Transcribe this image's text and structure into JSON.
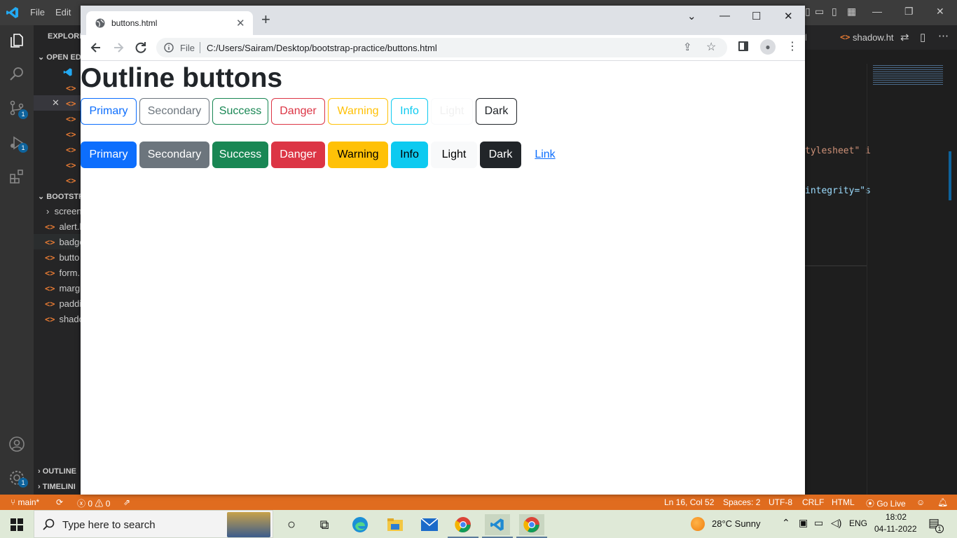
{
  "vscode": {
    "menu": [
      "File",
      "Edit"
    ],
    "explorer_head": "EXPLORER",
    "open_editors_head": "OPEN ED",
    "project_head": "BOOTSTR",
    "folder": "screen",
    "files": [
      "alert.h",
      "badge",
      "butto",
      "form.h",
      "margi",
      "paddi",
      "shado"
    ],
    "outline_head": "OUTLINE",
    "timeline_head": "TIMELINI",
    "right_tab_partial": "l",
    "right_tab": "shadow.ht",
    "code_line1": "tylesheet\" i",
    "code_line2": "integrity=\"s",
    "badges": [
      "1",
      "1",
      "1"
    ],
    "status": {
      "branch": "main*",
      "errors": "0",
      "warnings": "0",
      "position": "Ln 16, Col 52",
      "spaces": "Spaces: 2",
      "encoding": "UTF-8",
      "eol": "CRLF",
      "language": "HTML",
      "golive": "Go Live"
    }
  },
  "chrome": {
    "tab_title": "buttons.html",
    "omnibox_scheme": "File",
    "url": "C:/Users/Sairam/Desktop/bootstrap-practice/buttons.html"
  },
  "page": {
    "heading": "Outline buttons",
    "outline_buttons": [
      "Primary",
      "Secondary",
      "Success",
      "Danger",
      "Warning",
      "Info",
      "Light",
      "Dark"
    ],
    "solid_buttons": [
      "Primary",
      "Secondary",
      "Success",
      "Danger",
      "Warning",
      "Info",
      "Light",
      "Dark",
      "Link"
    ]
  },
  "taskbar": {
    "search_placeholder": "Type here to search",
    "weather": "28°C  Sunny",
    "language": "ENG",
    "time": "18:02",
    "date": "04-11-2022",
    "notification_count": "1"
  }
}
